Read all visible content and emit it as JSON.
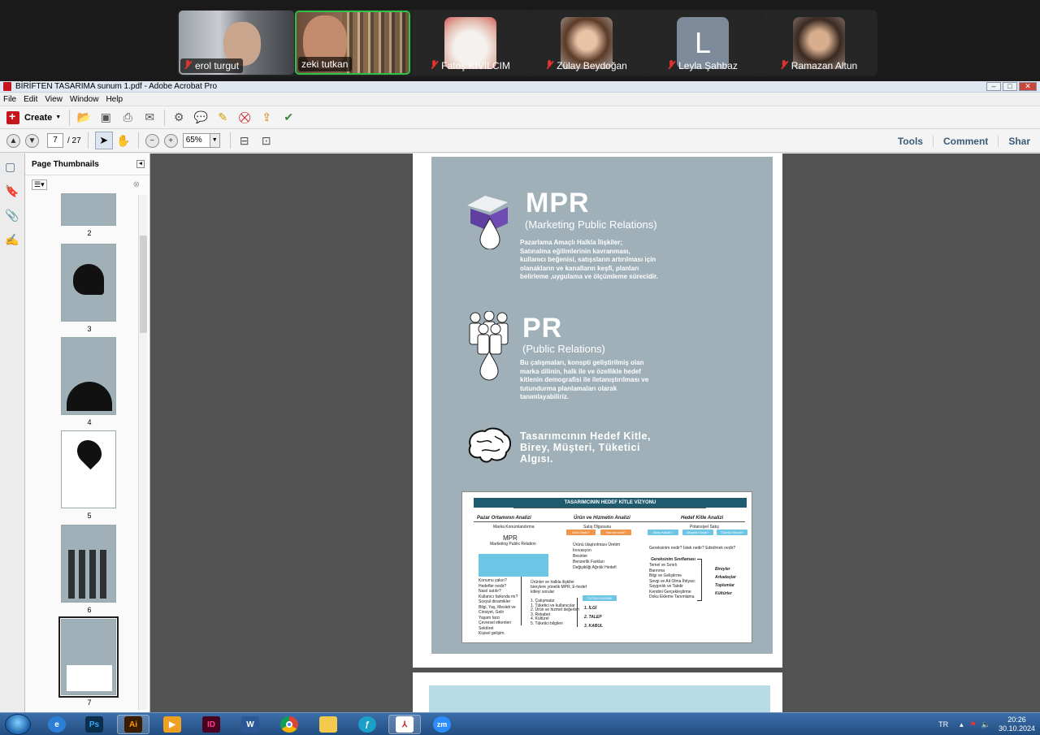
{
  "zoom": {
    "participants": [
      {
        "name": "erol turgut",
        "muted": true,
        "video": true,
        "active": false
      },
      {
        "name": "zeki tutkan",
        "muted": false,
        "video": true,
        "active": true
      },
      {
        "name": "Fatoş KIVILCIM",
        "muted": true,
        "video": false,
        "active": false
      },
      {
        "name": "Zülay Beydoğan",
        "muted": true,
        "video": false,
        "active": false
      },
      {
        "name": "Leyla Şahbaz",
        "muted": true,
        "video": false,
        "active": false,
        "initial": "L"
      },
      {
        "name": "Ramazan Altun",
        "muted": true,
        "video": false,
        "active": false
      }
    ]
  },
  "window": {
    "title": "BİRİFTEN TASARIMA sunum 1.pdf - Adobe Acrobat Pro"
  },
  "menu": [
    "File",
    "Edit",
    "View",
    "Window",
    "Help"
  ],
  "toolbar": {
    "create_label": "Create",
    "page_current": "7",
    "page_total": "/ 27",
    "zoom_value": "65%",
    "tabs": [
      "Tools",
      "Comment",
      "Shar"
    ]
  },
  "thumbnails": {
    "title": "Page Thumbnails",
    "pages": [
      "2",
      "3",
      "4",
      "5",
      "6",
      "7"
    ],
    "selected": "7"
  },
  "slide": {
    "mpr_title": "MPR",
    "mpr_sub": "(Marketing Public Relations)",
    "mpr_text": [
      "Pazarlama Amaçlı Halkla İlişkiler;",
      "Satınalma eğilimlerinin kavranması,",
      "kullanıcı beğenisi, satışsların artırılması  için",
      "olanakların ve kanalların keşfi,  planları",
      "belirleme ,uygulama ve ölçümleme sürecidir."
    ],
    "pr_title": "PR",
    "pr_sub": "(Public Relations)",
    "pr_text": [
      "Bu çalışmaları, konspti geliştirilmiş olan",
      "marka dilinin, halk ile ve özellikle hedef",
      "kitlenin demografisi ile iletanıştırılması ve",
      "tutundurma  planlamaları olarak",
      "tanımlayabiliriz."
    ],
    "hedef_text": [
      "Tasarımcının Hedef Kitle,",
      "Birey, Müşteri, Tüketici",
      "Algısı."
    ]
  },
  "vizyon": {
    "head": "TASARIMCININ HEDEF KİTLE VİZYONU",
    "col1": "Pazar Ortamının Analizi",
    "col2": "Ürün ve Hizmetin Analizi",
    "col3": "Hedef Kitle Analizi",
    "col1_sub": "Marka Konumlandırma",
    "col2_sub": "Satış Olgusunu",
    "col3_sub": "Potansiyel Satış",
    "mpr": "MPR",
    "mpr_sub": "Marketing Public Relation",
    "chip_urun": "Ürün Nedir?",
    "chip_hizmet": "Hizmet nedir?",
    "chip_birey": "Birey Kimdir?",
    "chip_musteri": "Müşteri Kimdir?",
    "chip_tuketici": "Tüketici Kimdir?",
    "urun_list": [
      "Ürünü ülaştırılması Üretim",
      "İnovasyon",
      "Besinler",
      "Benzerlik Farkları",
      "Değişikliği Ağrılık Hedefi"
    ],
    "soru": "Gereksinim nedir?    İstek nedir?    Edinilmek nedir?",
    "siniflama": "Gereksinim Sınıflaması",
    "siniflama_list": [
      "Temel ve Sınırlı",
      "Barınma",
      "Bilgi ve Geliştirme",
      "Sevgi ve Ait Olma İhtiyacı",
      "Saygınlık ve Takdir",
      "Kendini Gerçekleştirme",
      "Doku Ekleme Tanımlama"
    ],
    "birey_list": [
      "Bireyler",
      "Arkadaşlar",
      "Toplumlar",
      "Kültürler"
    ],
    "left_list": [
      "Konumu yakın?",
      "Hedefler nedir?",
      "Nasıl satılır?",
      "Kullanıcı farkında mı?",
      "Sosyal dinamikler",
      "Bilgi, Yaş, Meslek ve",
      "Cinsiyet, Gelir",
      "Yaşam tarzı",
      "Çevresel etkenleri",
      "Sektörel",
      "Kişisel gelişim."
    ],
    "mid_list": [
      "1. Çalışmalar",
      "1. Tüketici ve kullanıcılar",
      "2. Ürün ve hizmet değerleri",
      "3. Rekabet",
      "4. Kültürel",
      "5. Tüketici bilgileri"
    ],
    "mid_head": "Ürünler ve halkla ilişkiler bireylere yönelik MPR, E-hedef kitleyi sorular",
    "tut_head": "TUTUM KURAMI",
    "tut_list": [
      "1. İLGİ",
      "2. TALEP",
      "3. KABUL"
    ]
  },
  "taskbar": {
    "apps": [
      "Ps",
      "Ai",
      "ID",
      "W",
      "zm"
    ],
    "lang": "TR",
    "time": "20:26",
    "date": "30.10.2024"
  }
}
